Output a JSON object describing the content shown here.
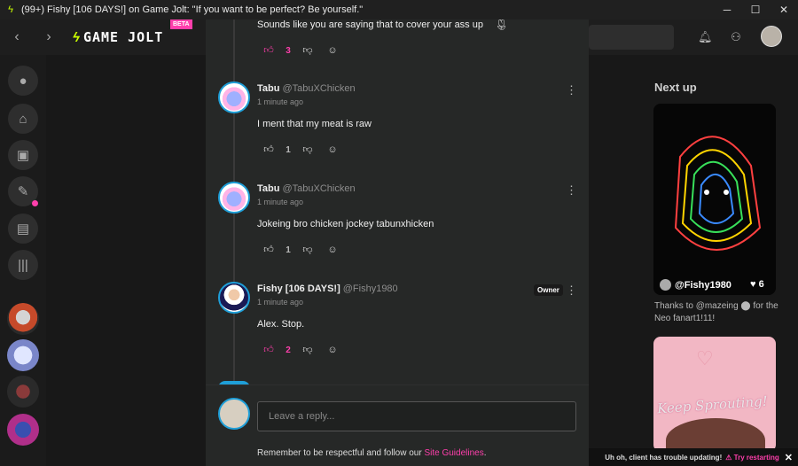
{
  "window": {
    "title": "(99+) Fishy [106 DAYS!] on Game Jolt: \"If you want to be perfect? Be yourself.\"",
    "minimize": "─",
    "maximize": "☐",
    "close": "✕"
  },
  "topbar": {
    "back": "‹",
    "forward": "›",
    "logo_text": "GAME JOLT",
    "beta_label": "BETA"
  },
  "next_up": {
    "heading": "Next up",
    "card1": {
      "user": "@Fishy1980",
      "likes": "6",
      "caption": "Thanks to @mazeing ⬤ for the Neo fanart1!11!"
    },
    "card2": {
      "text": "Keep Sprouting!"
    }
  },
  "update_bar": {
    "message": "Uh oh, client has trouble updating!",
    "retry": "Try restarting",
    "close": "✕"
  },
  "comments": [
    {
      "name": "",
      "handle": "",
      "time": "",
      "body": "Sounds like you are saying that to cover your ass up",
      "likes": "3",
      "liked": true
    },
    {
      "name": "Tabu",
      "handle": "@TabuXChicken",
      "time": "1 minute ago",
      "body": "I ment that my meat is raw",
      "likes": "1",
      "liked": false
    },
    {
      "name": "Tabu",
      "handle": "@TabuXChicken",
      "time": "1 minute ago",
      "body": "Jokeing bro chicken jockey tabunxhicken",
      "likes": "1",
      "liked": false
    },
    {
      "name": "Fishy [106 DAYS!]",
      "handle": "@Fishy1980",
      "time": "1 minute ago",
      "body": "Alex. Stop.",
      "likes": "2",
      "liked": true,
      "badge": "Owner"
    }
  ],
  "reply": {
    "placeholder": "Leave a reply...",
    "note_prefix": "Remember to be respectful and follow our ",
    "note_link": "Site Guidelines",
    "note_suffix": "."
  },
  "colors": {
    "accent": "#ff3fac",
    "brand": "#ccff00",
    "modal_bg": "#262827"
  }
}
